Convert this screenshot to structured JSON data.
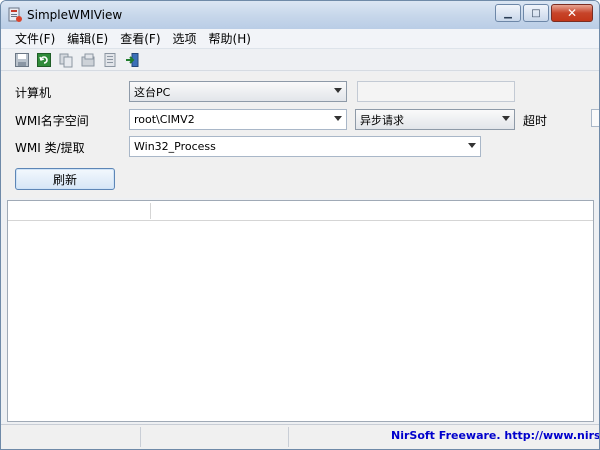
{
  "window": {
    "title": "SimpleWMIView",
    "minimize": "▁",
    "maximize": "□",
    "close": "✕"
  },
  "menu": [
    "文件(F)",
    "编辑(E)",
    "查看(F)",
    "选项",
    "帮助(H)"
  ],
  "toolbar": {
    "icons": [
      "save-icon",
      "refresh-icon",
      "copy-icon",
      "properties-icon",
      "html-report-icon",
      "exit-icon"
    ]
  },
  "form": {
    "computer_label": "计算机",
    "computer_value": "这台PC",
    "namespace_label": "WMI名字空间",
    "namespace_value": "root\\CIMV2",
    "request_mode": "异步请求",
    "timeout_label": "超时",
    "class_label": "WMI 类/提取",
    "class_value": "Win32_Process",
    "refresh_button": "刷新"
  },
  "statusbar": {
    "link": "NirSoft Freeware.  http://www.nirsoft.net"
  },
  "colors": {
    "link": "#0000cc",
    "close_button": "#c7442a"
  }
}
